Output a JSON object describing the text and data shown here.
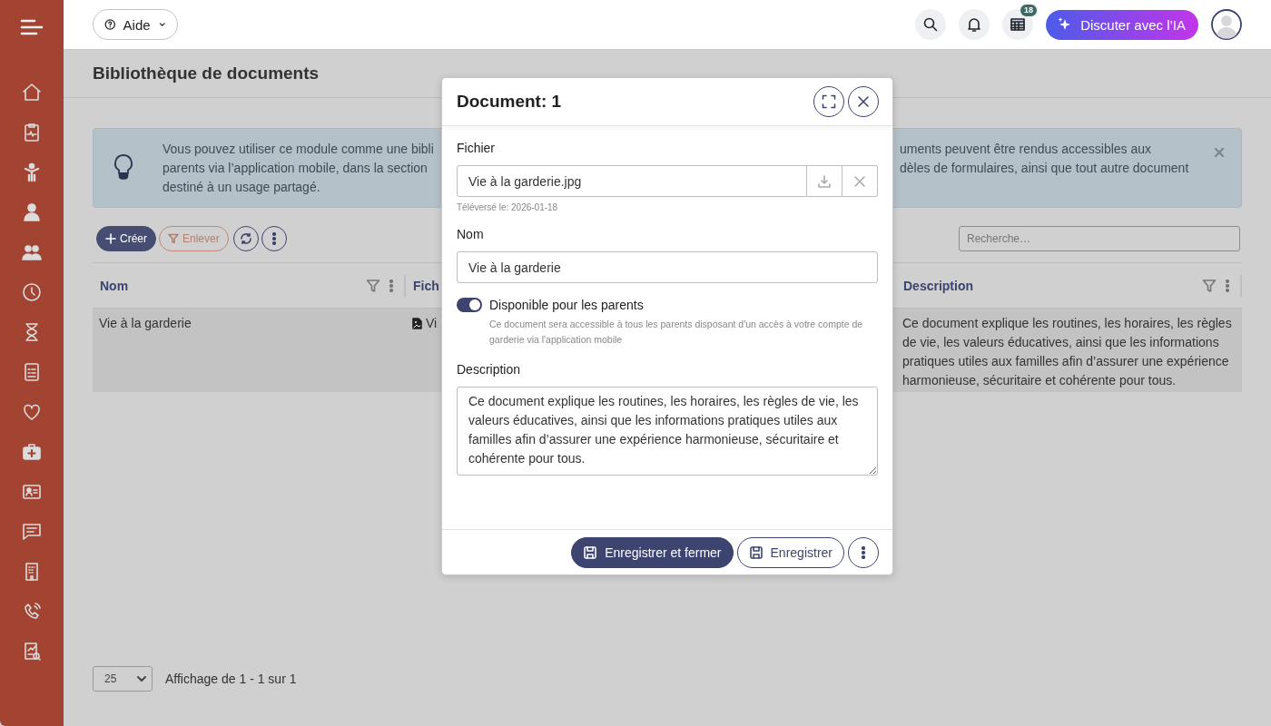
{
  "topbar": {
    "help_button": "Aide",
    "notification_badge": "18",
    "ai_button": "Discuter avec l’IA"
  },
  "page": {
    "title": "Bibliothèque de documents"
  },
  "info_banner": {
    "left_lines": [
      "Vous pouvez utiliser ce module comme une bibli",
      "parents via l’application mobile, dans la section",
      "destiné à un usage partagé."
    ],
    "right_lines": [
      "uments peuvent être rendus accessibles aux",
      "dèles de formulaires, ainsi que tout autre document"
    ]
  },
  "toolbar": {
    "buttons": [
      {
        "kind": "create",
        "label": "Créer"
      },
      {
        "kind": "filter",
        "label": "Enlever"
      },
      {
        "kind": "refresh"
      },
      {
        "kind": "more"
      }
    ],
    "search": {
      "placeholder": "Recherche…"
    }
  },
  "table": {
    "columns": [
      {
        "label": "Nom"
      },
      {
        "label": "Fich"
      },
      {
        "label": "Description"
      }
    ],
    "rows": [
      {
        "selected": true,
        "cells": [
          "Vie à la garderie",
          "Vi",
          "Ce document explique les routines, les horaires, les règles de vie, les valeurs éducatives, ainsi que les informations pratiques utiles aux familles afin d’assurer une expérience harmonieuse, sécuritaire et cohérente pour tous."
        ]
      }
    ]
  },
  "pagination": {
    "page_size": "25",
    "summary": "Affichage de 1 - 1 sur 1"
  },
  "dialog": {
    "title": "Document: 1",
    "fields": [
      {
        "kind": "file",
        "label": "Fichier",
        "value": "Vie à la garderie.jpg",
        "hint": "Téléversé le: 2026-01-18"
      },
      {
        "kind": "text",
        "label": "Nom",
        "value": "Vie à la garderie"
      },
      {
        "kind": "toggle",
        "label": "Disponible pour les parents",
        "on": true,
        "hint": "Ce document sera accessible à tous les parents disposant d'un accès à votre compte de garderie via l'application mobile"
      },
      {
        "kind": "textarea",
        "label": "Description",
        "value": "Ce document explique les routines, les horaires, les règles de vie, les valeurs éducatives, ainsi que les informations pratiques utiles aux familles afin d’assurer une expérience harmonieuse, sécuritaire et cohérente pour tous."
      }
    ],
    "buttons": [
      {
        "kind": "primary",
        "label": "Enregistrer et fermer"
      },
      {
        "kind": "secondary",
        "label": "Enregistrer"
      },
      {
        "kind": "more"
      }
    ]
  }
}
